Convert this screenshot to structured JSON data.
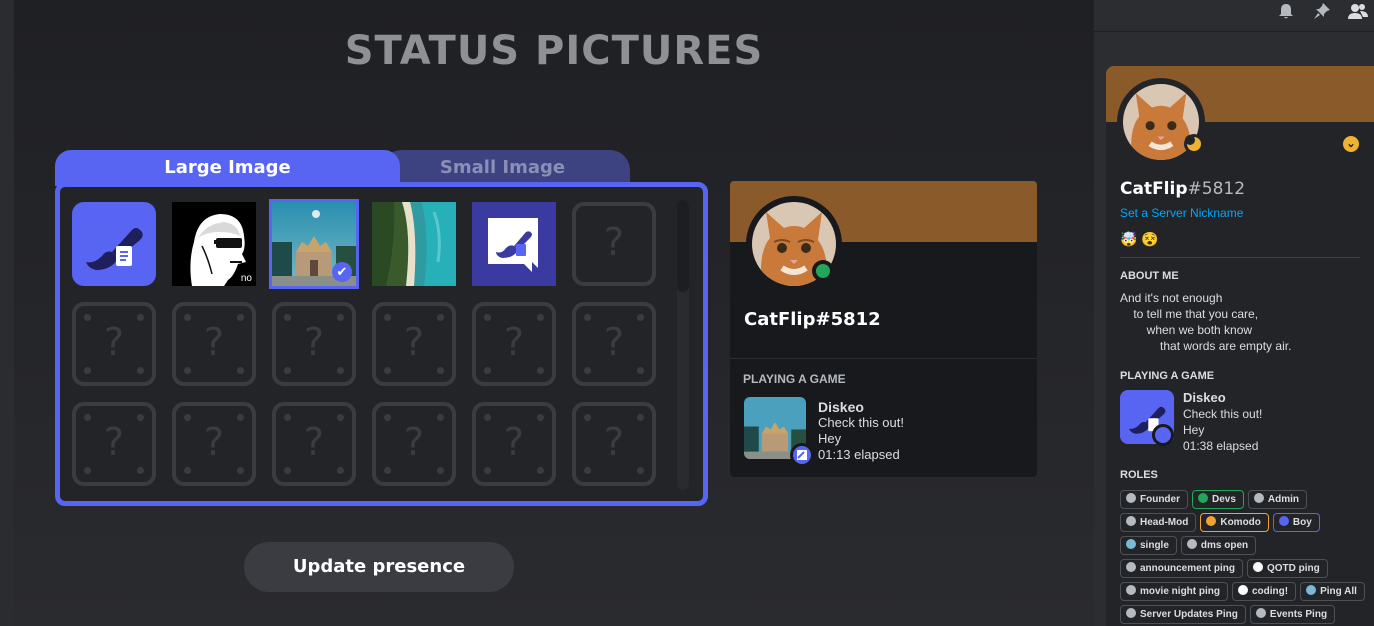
{
  "page": {
    "title": "STATUS PICTURES"
  },
  "tabs": {
    "large": "Large Image",
    "small": "Small Image"
  },
  "grid": {
    "placeholder_glyph": "?",
    "nsfw_label": "no",
    "tiles": [
      {
        "name": "diskeo-logo",
        "selected": false
      },
      {
        "name": "meme-face",
        "selected": false
      },
      {
        "name": "temple-photo",
        "selected": true
      },
      {
        "name": "coast-photo",
        "selected": false
      },
      {
        "name": "diskeo-chat-logo",
        "selected": false
      }
    ]
  },
  "buttons": {
    "update": "Update presence"
  },
  "card": {
    "username": "CatFlip#5812",
    "section": "PLAYING A GAME",
    "game": {
      "name": "Diskeo",
      "details": "Check this out!",
      "state": "Hey",
      "elapsed": "01:13 elapsed"
    }
  },
  "sidebar": {
    "username": "CatFlip",
    "discriminator": "#5812",
    "nickname_link": "Set a Server Nickname",
    "badges": "🤯 😵",
    "about_heading": "ABOUT ME",
    "about": [
      "And it's not enough",
      "    to tell me that you care,",
      "        when we both know",
      "            that words are empty air."
    ],
    "game_heading": "PLAYING A GAME",
    "game": {
      "name": "Diskeo",
      "details": "Check this out!",
      "state": "Hey",
      "elapsed": "01:38 elapsed"
    },
    "roles_heading": "ROLES",
    "roles": [
      {
        "name": "Founder",
        "color": "#b5bac1"
      },
      {
        "name": "Devs",
        "color": "#23a55a"
      },
      {
        "name": "Admin",
        "color": "#b5bac1"
      },
      {
        "name": "Head-Mod",
        "color": "#b5bac1"
      },
      {
        "name": "Komodo",
        "color": "#f0a232"
      },
      {
        "name": "Boy",
        "color": "#5865f2"
      },
      {
        "name": "single",
        "color": "#7ab8d8"
      },
      {
        "name": "dms open",
        "color": "#b5bac1"
      },
      {
        "name": "announcement ping",
        "color": "#b5bac1"
      },
      {
        "name": "QOTD ping",
        "color": "#ffffff"
      },
      {
        "name": "movie night ping",
        "color": "#b5bac1"
      },
      {
        "name": "coding!",
        "color": "#ffffff"
      },
      {
        "name": "Ping All",
        "color": "#7ab8d8"
      },
      {
        "name": "Server Updates Ping",
        "color": "#b5bac1"
      },
      {
        "name": "Events Ping",
        "color": "#b5bac1"
      }
    ]
  },
  "colors": {
    "accent": "#5865f2",
    "banner": "#8b5a2b",
    "online": "#23a55a",
    "idle": "#f0b232"
  },
  "icons": [
    "bell-icon",
    "pin-icon",
    "members-icon",
    "checkmark-icon",
    "chevron-down-icon"
  ]
}
